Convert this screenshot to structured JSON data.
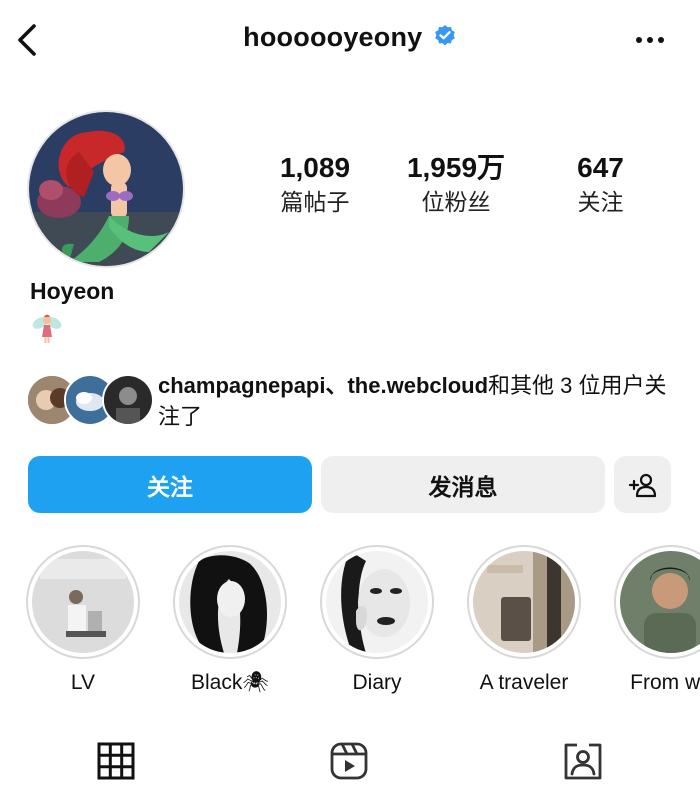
{
  "header": {
    "username": "hoooooyeony",
    "verified_color": "#3897f0"
  },
  "profile": {
    "stats": [
      {
        "value": "1,089",
        "label": "篇帖子"
      },
      {
        "value": "1,959万",
        "label": "位粉丝"
      },
      {
        "value": "647",
        "label": "关注"
      }
    ],
    "display_name": "Hoyeon",
    "bio_emoji": "fairy"
  },
  "mutual": {
    "names": "champagnepapi、the.webcloud",
    "suffix": "和其他 3 位用户关注了"
  },
  "actions": {
    "follow_label": "关注",
    "message_label": "发消息",
    "accent_color": "#1fa1f2"
  },
  "highlights": [
    {
      "label": "LV"
    },
    {
      "label": "Black🕷"
    },
    {
      "label": "Diary"
    },
    {
      "label": "A traveler"
    },
    {
      "label": "From wo"
    }
  ],
  "tabs": [
    {
      "icon": "grid-icon"
    },
    {
      "icon": "reels-icon"
    },
    {
      "icon": "tagged-icon"
    }
  ]
}
